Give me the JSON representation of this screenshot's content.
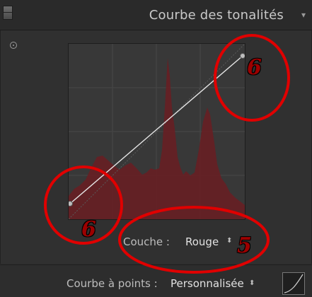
{
  "header": {
    "title": "Courbe des tonalités",
    "collapse_icon": "triangle-down-icon",
    "toggle_icon": "panel-toggle-icon"
  },
  "tool": {
    "target_icon": "target-adjustment-icon"
  },
  "curve": {
    "channel_label": "Couche :",
    "channel_value": "Rouge",
    "histogram_color": "#7a1e24",
    "curve_color": "#e6e6e6",
    "black_point": [
      0,
      0.0
    ],
    "white_point": [
      1,
      1.0
    ]
  },
  "point_curve": {
    "label": "Courbe à points :",
    "value": "Personnalisée",
    "thumb_icon": "curve-thumbnail-icon"
  },
  "annotations": {
    "label_top_right": "6",
    "label_bottom_left": "6",
    "label_channel": "5",
    "ring_color": "#e00000"
  },
  "selector_arrows": "⬍"
}
